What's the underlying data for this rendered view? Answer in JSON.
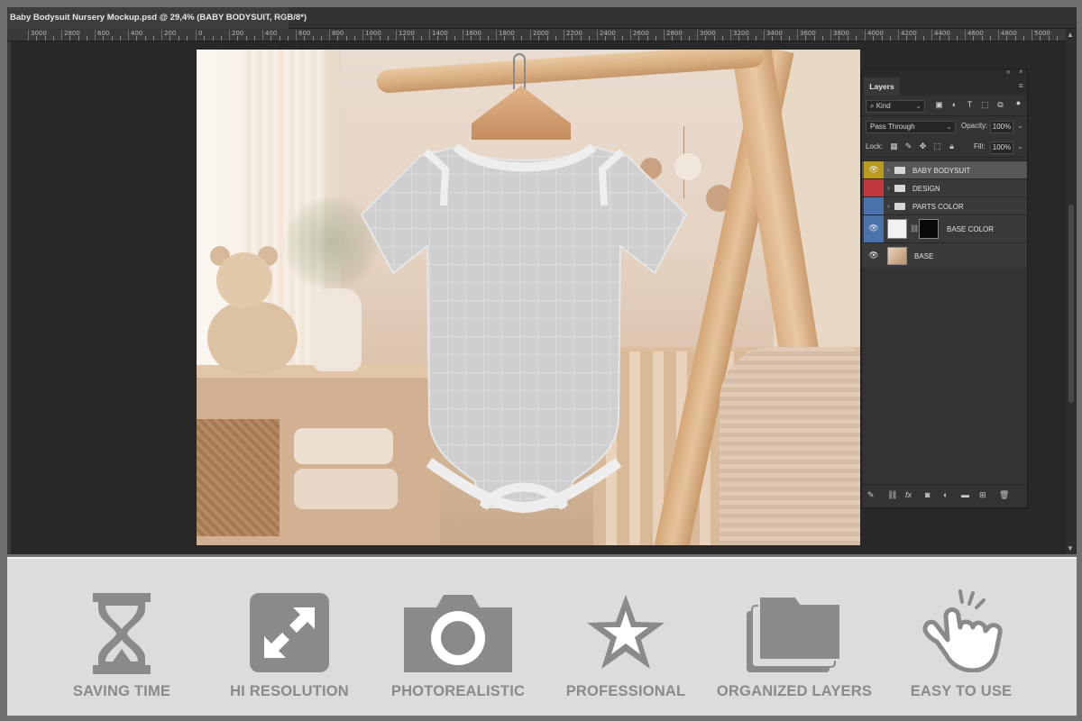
{
  "document": {
    "tab_title": "Baby Bodysuit Nursery Mockup.psd @ 29,4% (BABY BODYSUIT, RGB/8*)",
    "tab_close": "×"
  },
  "ruler": {
    "labels": [
      "3000",
      "2800",
      "600",
      "400",
      "200",
      "0",
      "200",
      "400",
      "600",
      "800",
      "1000",
      "1200",
      "1400",
      "1600",
      "1800",
      "2000",
      "2200",
      "2400",
      "2600",
      "2800",
      "3000",
      "3200",
      "3400",
      "3600",
      "3800",
      "4000",
      "4200",
      "4400",
      "4600",
      "4800",
      "5000"
    ]
  },
  "layers_panel": {
    "tab_label": "Layers",
    "kind_label": "Kind",
    "blend_mode": "Pass Through",
    "opacity_label": "Opacity:",
    "opacity_value": "100%",
    "lock_label": "Lock:",
    "fill_label": "Fill:",
    "fill_value": "100%",
    "layers": [
      {
        "name": "BABY BODYSUIT",
        "type": "group",
        "visible": true,
        "color": "#b89a1e",
        "selected": true
      },
      {
        "name": "DESIGN",
        "type": "group",
        "visible": false,
        "color": "#c0393e",
        "selected": false
      },
      {
        "name": "PARTS COLOR",
        "type": "group",
        "visible": false,
        "color": "#4a72ad",
        "selected": false
      },
      {
        "name": "BASE COLOR",
        "type": "layer-with-mask",
        "visible": true,
        "color": "#4a72ad",
        "selected": false
      },
      {
        "name": "BASE",
        "type": "image",
        "visible": true,
        "color": "none",
        "selected": false
      }
    ]
  },
  "features": [
    {
      "label": "SAVING TIME",
      "icon": "hourglass-icon"
    },
    {
      "label": "HI RESOLUTION",
      "icon": "expand-arrows-icon"
    },
    {
      "label": "PHOTOREALISTIC",
      "icon": "camera-icon"
    },
    {
      "label": "PROFESSIONAL",
      "icon": "star-icon"
    },
    {
      "label": "ORGANIZED LAYERS",
      "icon": "stacked-folders-icon"
    },
    {
      "label": "EASY TO USE",
      "icon": "tap-hand-icon"
    }
  ],
  "colors": {
    "feature_icon": "#8a8a8a",
    "feature_bg": "#dcdcdc",
    "workspace_bg": "#282828"
  }
}
